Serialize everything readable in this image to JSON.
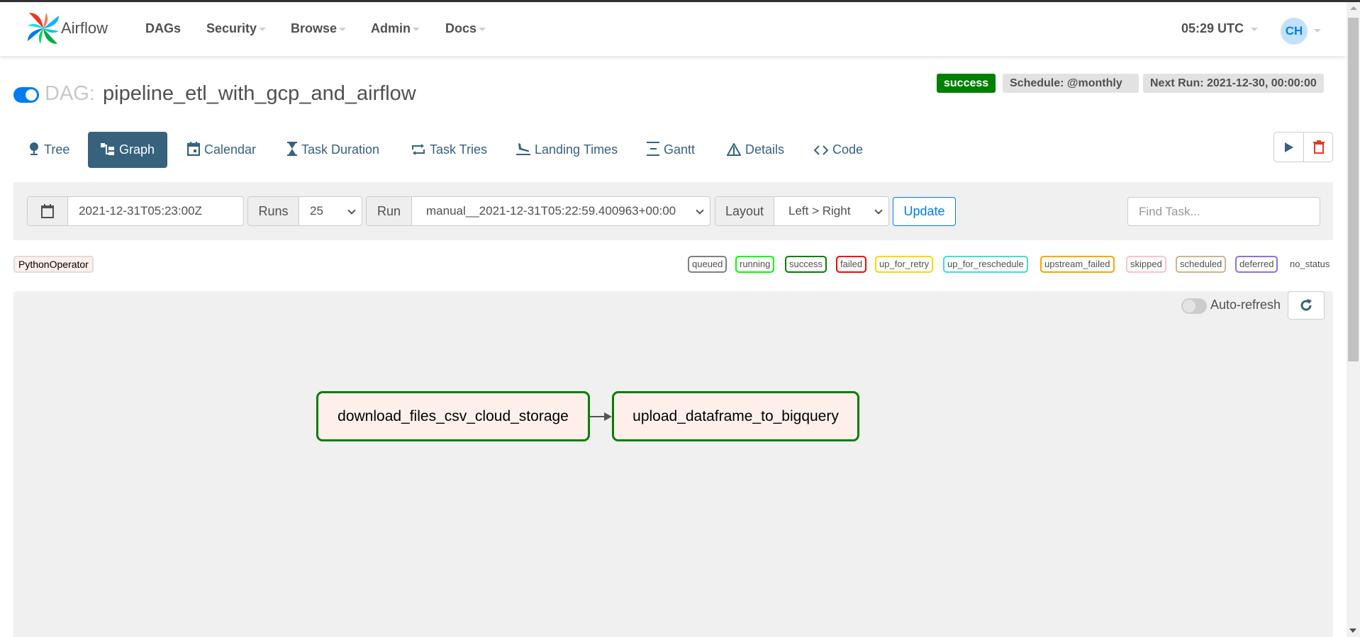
{
  "app": {
    "brand": "Airflow"
  },
  "nav": {
    "items": [
      {
        "label": "DAGs",
        "dropdown": false
      },
      {
        "label": "Security",
        "dropdown": true
      },
      {
        "label": "Browse",
        "dropdown": true
      },
      {
        "label": "Admin",
        "dropdown": true
      },
      {
        "label": "Docs",
        "dropdown": true
      }
    ],
    "clock": "05:29 UTC",
    "user_initials": "CH"
  },
  "dag": {
    "label": "DAG:",
    "id": "pipeline_etl_with_gcp_and_airflow",
    "paused": false,
    "status": "success",
    "schedule": "Schedule: @monthly",
    "next_run": "Next Run: 2021-12-30, 00:00:00"
  },
  "tabs": [
    {
      "label": "Tree",
      "icon": "tree-icon",
      "active": false
    },
    {
      "label": "Graph",
      "icon": "graph-icon",
      "active": true
    },
    {
      "label": "Calendar",
      "icon": "calendar-icon",
      "active": false
    },
    {
      "label": "Task Duration",
      "icon": "hourglass-icon",
      "active": false
    },
    {
      "label": "Task Tries",
      "icon": "retry-icon",
      "active": false
    },
    {
      "label": "Landing Times",
      "icon": "plane-landing-icon",
      "active": false
    },
    {
      "label": "Gantt",
      "icon": "gantt-icon",
      "active": false
    },
    {
      "label": "Details",
      "icon": "details-icon",
      "active": false
    },
    {
      "label": "Code",
      "icon": "code-icon",
      "active": false
    }
  ],
  "actions": {
    "trigger": "play-icon",
    "delete": "trash-icon"
  },
  "form": {
    "base_date": "2021-12-31T05:23:00Z",
    "runs_label": "Runs",
    "runs_value": "25",
    "run_label": "Run",
    "run_value": "manual__2021-12-31T05:22:59.400963+00:00",
    "layout_label": "Layout",
    "layout_value": "Left > Right",
    "update_label": "Update",
    "find_task_placeholder": "Find Task..."
  },
  "operator_legend": [
    {
      "label": "PythonOperator",
      "color": "#ffefeb"
    }
  ],
  "state_legend": [
    {
      "label": "queued",
      "color": "#808080"
    },
    {
      "label": "running",
      "color": "#00ff00"
    },
    {
      "label": "success",
      "color": "#008000"
    },
    {
      "label": "failed",
      "color": "#ff0000"
    },
    {
      "label": "up_for_retry",
      "color": "#ffd700"
    },
    {
      "label": "up_for_reschedule",
      "color": "#40e0d0"
    },
    {
      "label": "upstream_failed",
      "color": "#ffa500"
    },
    {
      "label": "skipped",
      "color": "#ffc0cb"
    },
    {
      "label": "scheduled",
      "color": "#d2b48c"
    },
    {
      "label": "deferred",
      "color": "#9370db"
    },
    {
      "label": "no_status",
      "color": ""
    }
  ],
  "graph": {
    "auto_refresh_label": "Auto-refresh",
    "auto_refresh_on": false,
    "nodes": [
      {
        "id": "download_files_csv_cloud_storage",
        "state": "success",
        "operator": "PythonOperator"
      },
      {
        "id": "upload_dataframe_to_bigquery",
        "state": "success",
        "operator": "PythonOperator"
      }
    ],
    "edges": [
      {
        "from": "download_files_csv_cloud_storage",
        "to": "upload_dataframe_to_bigquery"
      }
    ]
  }
}
